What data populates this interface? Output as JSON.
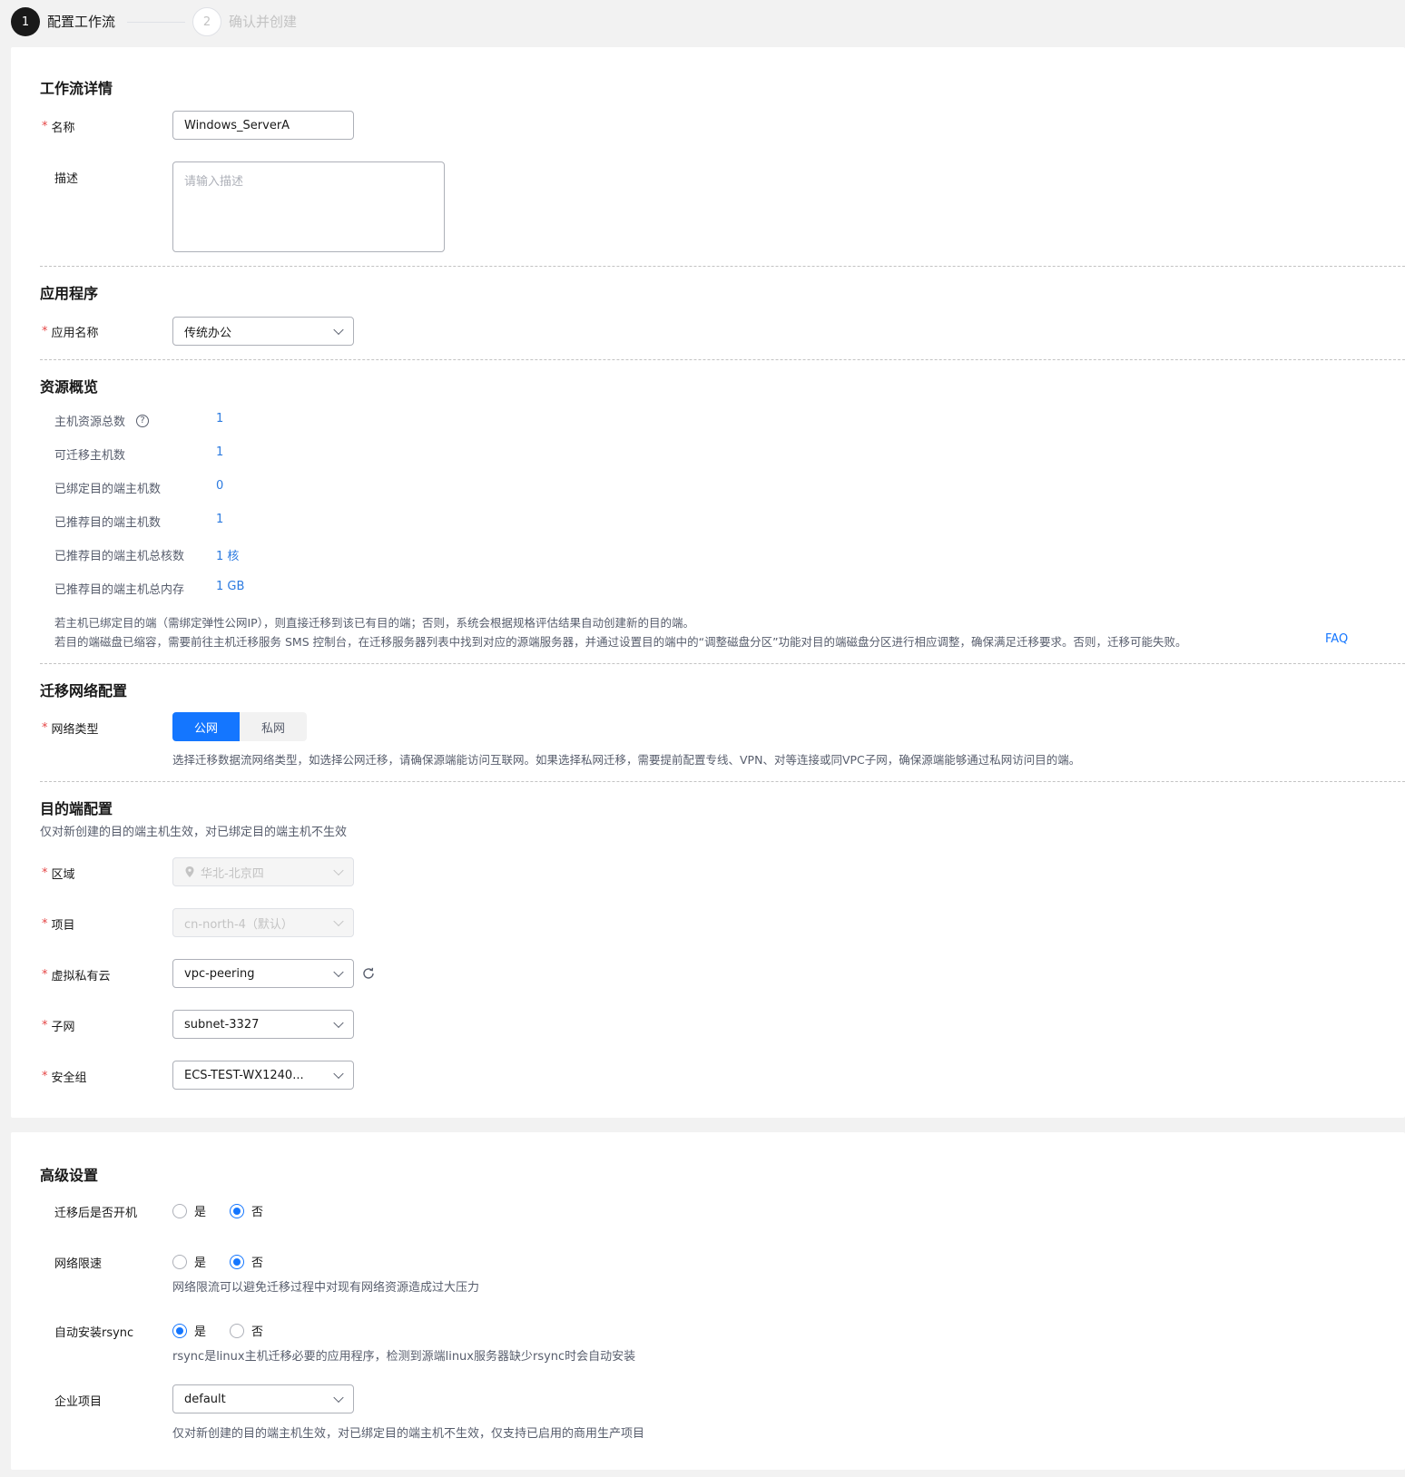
{
  "steps": [
    {
      "num": "1",
      "label": "配置工作流"
    },
    {
      "num": "2",
      "label": "确认并创建"
    }
  ],
  "workflow": {
    "title": "工作流详情",
    "name_label": "名称",
    "name_value": "Windows_ServerA",
    "desc_label": "描述",
    "desc_placeholder": "请输入描述"
  },
  "application": {
    "title": "应用程序",
    "app_label": "应用名称",
    "app_value": "传统办公"
  },
  "resources": {
    "title": "资源概览",
    "items": [
      {
        "label": "主机资源总数",
        "value": "1"
      },
      {
        "label": "可迁移主机数",
        "value": "1"
      },
      {
        "label": "已绑定目的端主机数",
        "value": "0"
      },
      {
        "label": "已推荐目的端主机数",
        "value": "1"
      },
      {
        "label": "已推荐目的端主机总核数",
        "value": "1 核"
      },
      {
        "label": "已推荐目的端主机总内存",
        "value": "1 GB"
      }
    ],
    "note1": "若主机已绑定目的端（需绑定弹性公网IP），则直接迁移到该已有目的端；否则，系统会根据规格评估结果自动创建新的目的端。",
    "note2": "若目的端磁盘已缩容，需要前往主机迁移服务 SMS 控制台，在迁移服务器列表中找到对应的源端服务器，并通过设置目的端中的“调整磁盘分区”功能对目的端磁盘分区进行相应调整，确保满足迁移要求。否则，迁移可能失败。",
    "faq": "FAQ"
  },
  "network": {
    "title": "迁移网络配置",
    "type_label": "网络类型",
    "options": [
      "公网",
      "私网"
    ],
    "note": "选择迁移数据流网络类型，如选择公网迁移，请确保源端能访问互联网。如果选择私网迁移，需要提前配置专线、VPN、对等连接或同VPC子网，确保源端能够通过私网访问目的端。"
  },
  "target": {
    "title": "目的端配置",
    "subtitle": "仅对新创建的目的端主机生效，对已绑定目的端主机不生效",
    "region_label": "区域",
    "region_value": "华北-北京四",
    "project_label": "项目",
    "project_value": "cn-north-4（默认）",
    "vpc_label": "虚拟私有云",
    "vpc_value": "vpc-peering",
    "subnet_label": "子网",
    "subnet_value": "subnet-3327",
    "sg_label": "安全组",
    "sg_value": "ECS-TEST-WX1240..."
  },
  "advanced": {
    "title": "高级设置",
    "yes": "是",
    "no": "否",
    "poweron_label": "迁移后是否开机",
    "speed_label": "网络限速",
    "speed_note": "网络限流可以避免迁移过程中对现有网络资源造成过大压力",
    "rsync_label": "自动安装rsync",
    "rsync_note": "rsync是linux主机迁移必要的应用程序，检测到源端linux服务器缺少rsync时会自动安装",
    "ep_label": "企业项目",
    "ep_value": "default",
    "ep_note": "仅对新创建的目的端主机生效，对已绑定目的端主机不生效，仅支持已启用的商用生产项目"
  },
  "colors": {
    "primary": "#1476ff",
    "required": "#e54545",
    "value_blue": "#2d7be0"
  }
}
